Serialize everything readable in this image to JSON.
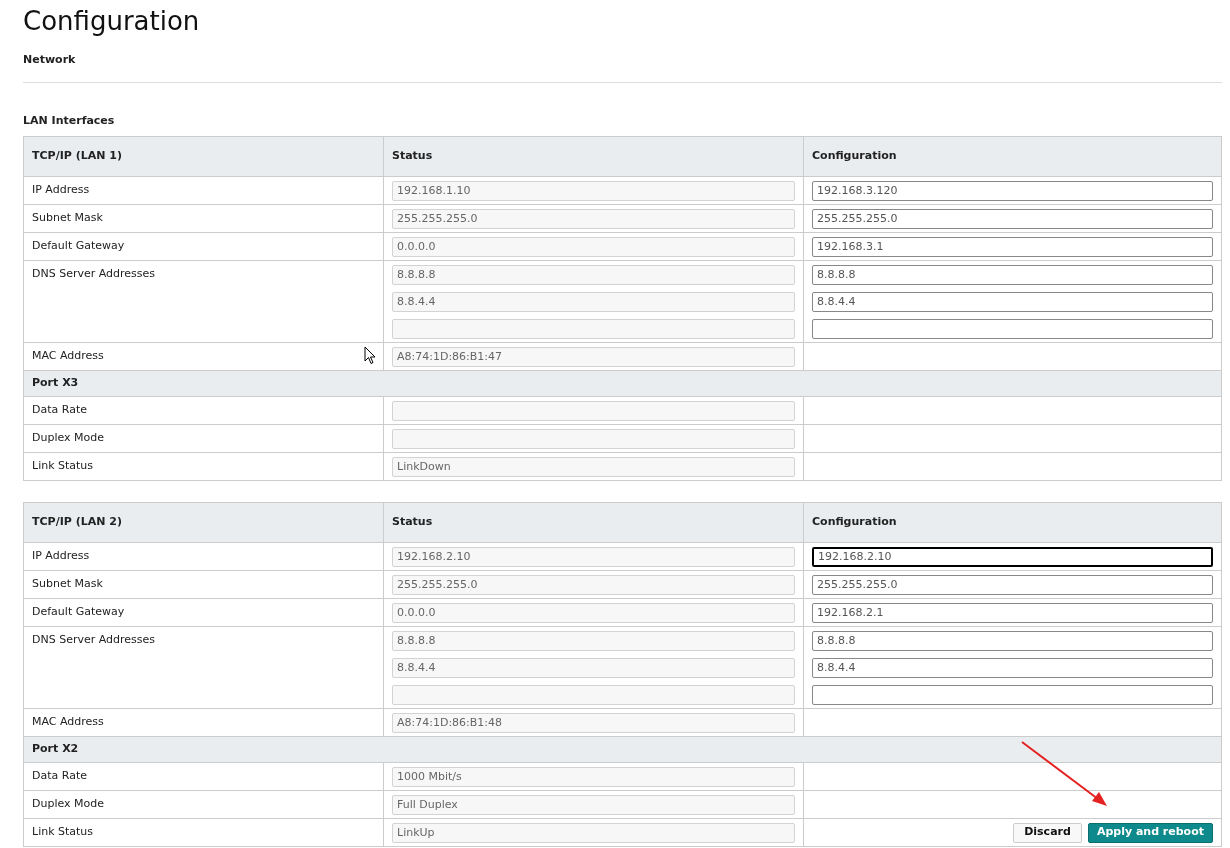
{
  "page_title": "Configuration",
  "subtitle": "Network",
  "section_title": "LAN Interfaces",
  "tables": [
    {
      "title": "TCP/IP (LAN 1)",
      "columns": [
        "Status",
        "Configuration"
      ],
      "rows": [
        {
          "kind": "field",
          "label": "IP Address",
          "status": [
            {
              "value": "192.168.1.10"
            }
          ],
          "config": [
            {
              "value": "192.168.3.120",
              "focused": false
            }
          ]
        },
        {
          "kind": "field",
          "label": "Subnet Mask",
          "status": [
            {
              "value": "255.255.255.0"
            }
          ],
          "config": [
            {
              "value": "255.255.255.0",
              "focused": false
            }
          ]
        },
        {
          "kind": "field",
          "label": "Default Gateway",
          "status": [
            {
              "value": "0.0.0.0"
            }
          ],
          "config": [
            {
              "value": "192.168.3.1",
              "focused": false
            }
          ]
        },
        {
          "kind": "field",
          "label": "DNS Server Addresses",
          "status": [
            {
              "value": "8.8.8.8"
            },
            {
              "value": "8.8.4.4"
            },
            {
              "kind": "empty"
            }
          ],
          "config": [
            {
              "value": "8.8.8.8",
              "focused": false
            },
            {
              "value": "8.8.4.4",
              "focused": false
            },
            {
              "focused": false
            }
          ]
        },
        {
          "kind": "field",
          "label": "MAC Address",
          "status": [
            {
              "value": "A8:74:1D:86:B1:47"
            }
          ]
        },
        {
          "kind": "section",
          "label": "Port X3"
        },
        {
          "kind": "field",
          "label": "Data Rate",
          "status": [
            {
              "kind": "empty"
            }
          ]
        },
        {
          "kind": "field",
          "label": "Duplex Mode",
          "status": [
            {
              "kind": "empty"
            }
          ]
        },
        {
          "kind": "field",
          "label": "Link Status",
          "status": [
            {
              "value": "LinkDown"
            }
          ]
        }
      ]
    },
    {
      "title": "TCP/IP (LAN 2)",
      "columns": [
        "Status",
        "Configuration"
      ],
      "rows": [
        {
          "kind": "field",
          "label": "IP Address",
          "status": [
            {
              "value": "192.168.2.10"
            }
          ],
          "config": [
            {
              "value": "192.168.2.10",
              "focused": true
            }
          ]
        },
        {
          "kind": "field",
          "label": "Subnet Mask",
          "status": [
            {
              "value": "255.255.255.0"
            }
          ],
          "config": [
            {
              "value": "255.255.255.0",
              "focused": false
            }
          ]
        },
        {
          "kind": "field",
          "label": "Default Gateway",
          "status": [
            {
              "value": "0.0.0.0"
            }
          ],
          "config": [
            {
              "value": "192.168.2.1",
              "focused": false
            }
          ]
        },
        {
          "kind": "field",
          "label": "DNS Server Addresses",
          "status": [
            {
              "value": "8.8.8.8"
            },
            {
              "value": "8.8.4.4"
            },
            {
              "kind": "empty"
            }
          ],
          "config": [
            {
              "value": "8.8.8.8",
              "focused": false
            },
            {
              "value": "8.8.4.4",
              "focused": false
            },
            {
              "focused": false
            }
          ]
        },
        {
          "kind": "field",
          "label": "MAC Address",
          "status": [
            {
              "value": "A8:74:1D:86:B1:48"
            }
          ]
        },
        {
          "kind": "section",
          "label": "Port X2"
        },
        {
          "kind": "field",
          "label": "Data Rate",
          "status": [
            {
              "value": "1000 Mbit/s"
            }
          ]
        },
        {
          "kind": "field",
          "label": "Duplex Mode",
          "status": [
            {
              "value": "Full Duplex"
            }
          ]
        },
        {
          "kind": "field",
          "label": "Link Status",
          "status": [
            {
              "value": "LinkUp"
            }
          ],
          "buttons": [
            {
              "label": "Discard",
              "kind": "secondary"
            },
            {
              "label": "Apply and reboot",
              "kind": "primary"
            }
          ]
        }
      ]
    }
  ]
}
